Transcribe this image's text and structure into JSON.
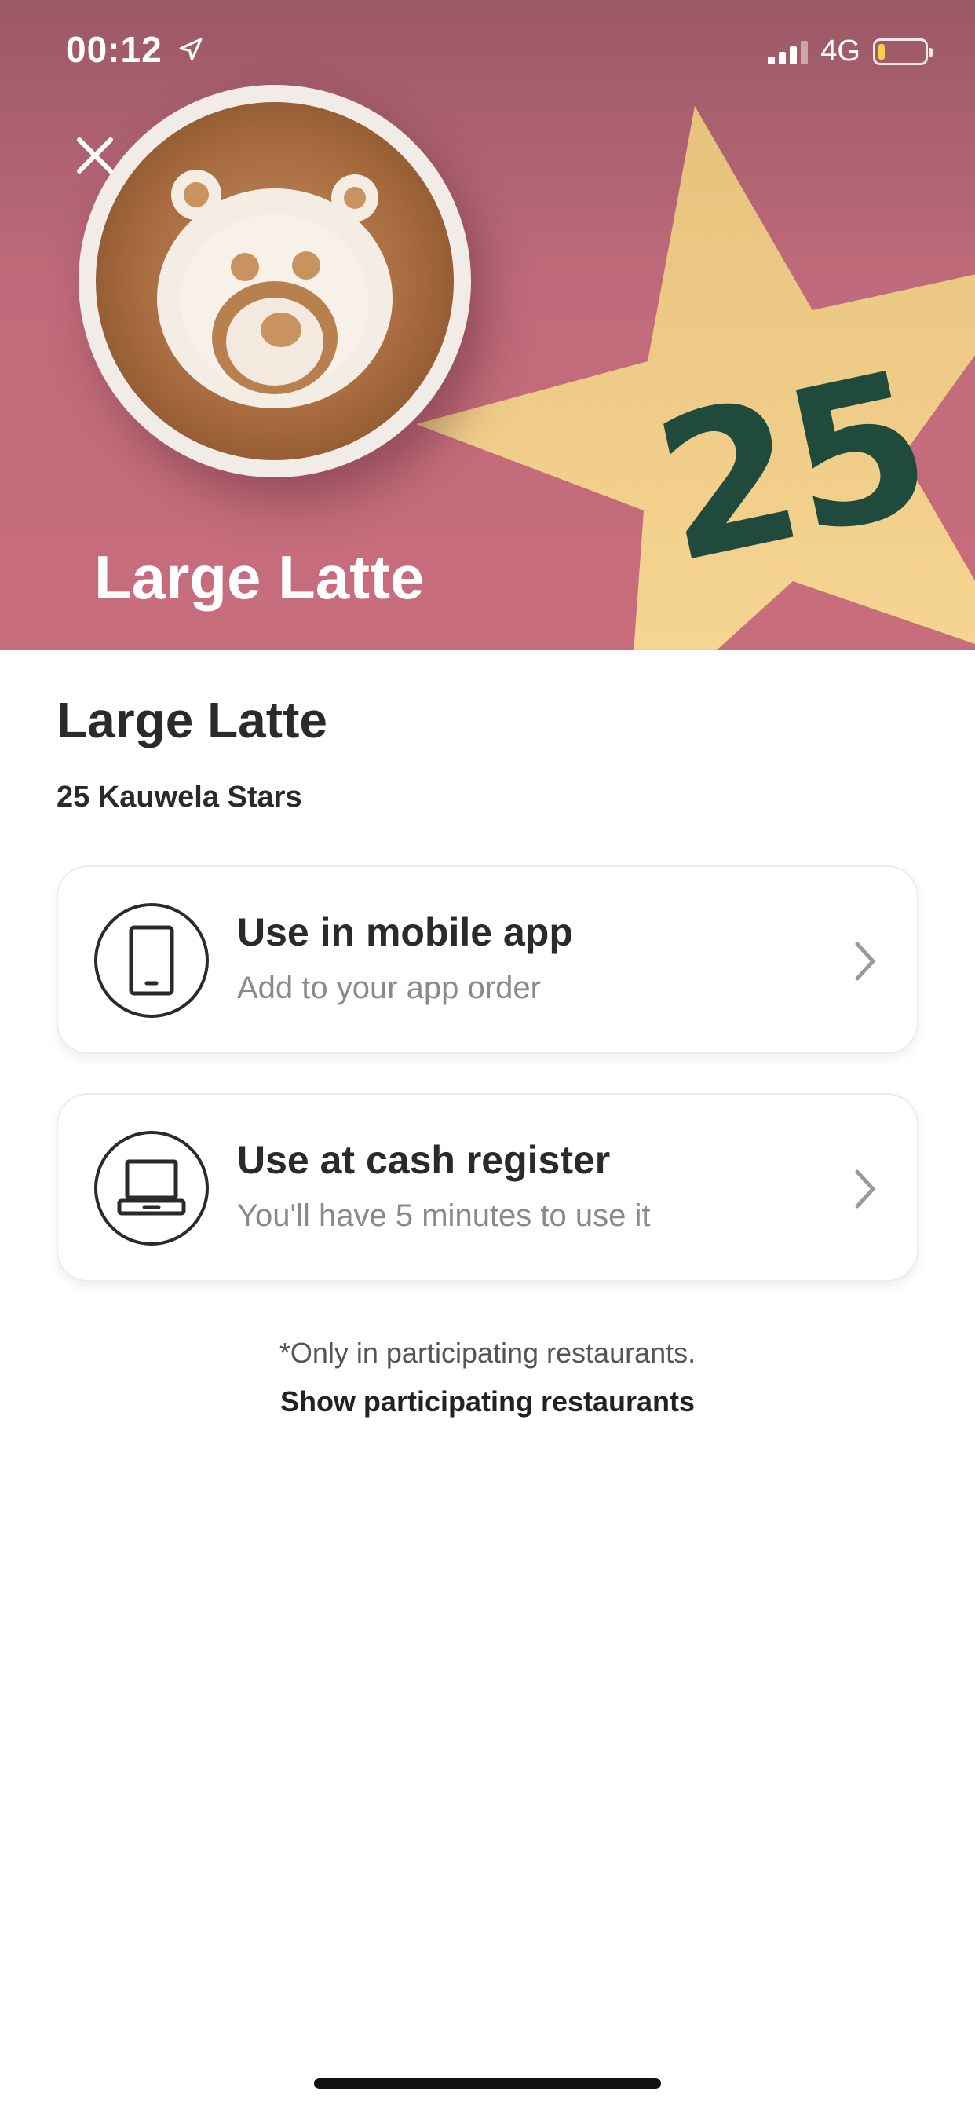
{
  "status_bar": {
    "time": "00:12",
    "network": "4G"
  },
  "hero": {
    "title": "Large Latte",
    "star_value": "25",
    "colors": {
      "background": "#c06b7b",
      "star": "#f6d28a",
      "star_number": "#1f4a3c"
    }
  },
  "reward": {
    "title": "Large Latte",
    "subtitle": "25 Kauwela Stars"
  },
  "options": [
    {
      "icon": "mobile-phone-icon",
      "title": "Use in mobile app",
      "subtitle": "Add to your app order"
    },
    {
      "icon": "laptop-icon",
      "title": "Use at cash register",
      "subtitle": "You'll have 5 minutes to use it"
    }
  ],
  "footer": {
    "note": "*Only in participating restaurants.",
    "link": "Show participating restaurants"
  }
}
